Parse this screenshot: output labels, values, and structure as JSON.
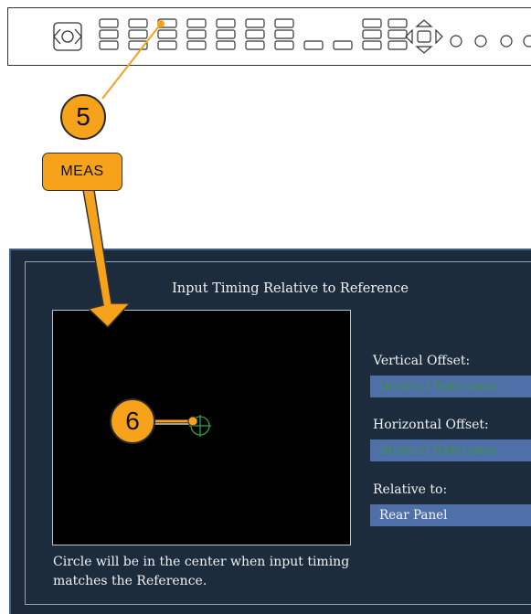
{
  "panel": {
    "name": "instrument-front-panel"
  },
  "callouts": {
    "step5": "5",
    "step6": "6",
    "meas_button": "MEAS",
    "color": "#f7a21b"
  },
  "display": {
    "title": "Input Timing Relative to Reference",
    "caption": "Circle will be in the center when input timing matches the Reference.",
    "fields": [
      {
        "label": "Vertical Offset:",
        "value": "Internal Reference",
        "state": "dim"
      },
      {
        "label": "Horizontal Offset:",
        "value": "Internal Reference",
        "state": "dim"
      },
      {
        "label": "Relative to:",
        "value": "Rear Panel",
        "state": "active"
      }
    ],
    "colors": {
      "background": "#1c2a3a",
      "plot": "#000000",
      "field_box": "#4f6fa8",
      "dim_text": "#3f8e52",
      "target": "#2fa34a"
    }
  }
}
